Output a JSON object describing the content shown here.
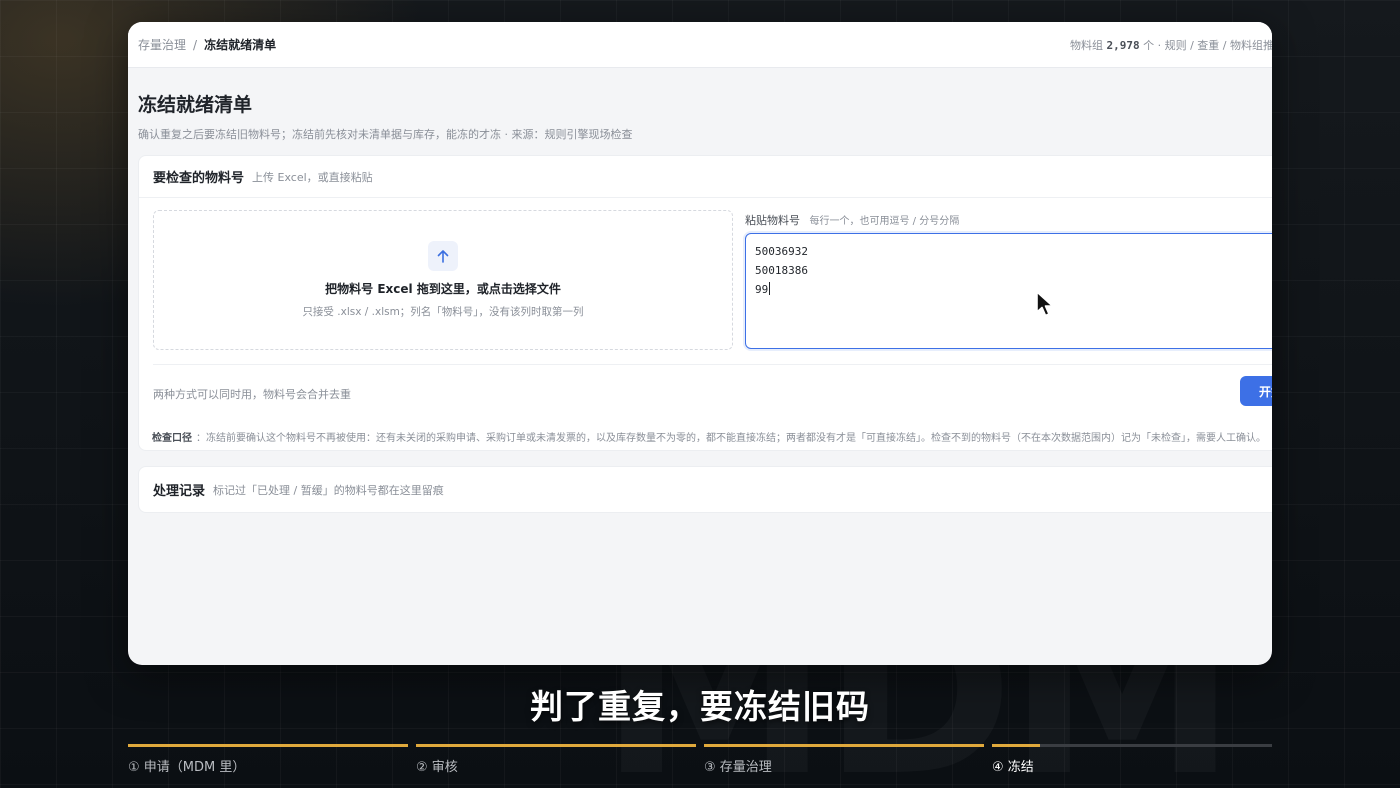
{
  "colors": {
    "accent": "#3d70e6",
    "progress": "#e0a93c",
    "progress_track": "#3a3d42"
  },
  "breadcrumb": {
    "parent": "存量治理",
    "separator": "/",
    "current": "冻结就绪清单"
  },
  "topbar_right": {
    "prefix": "物料组",
    "count": "2,978",
    "suffix": "个 · 规则 / 查重 / 物料组推"
  },
  "page": {
    "title": "冻结就绪清单",
    "description": "确认重复之后要冻结旧物料号；冻结前先核对未清单据与库存，能冻的才冻 · 来源：规则引擎现场检查"
  },
  "input_card": {
    "title": "要检查的物料号",
    "subtitle": "上传 Excel，或直接粘贴",
    "dropzone": {
      "icon": "upload-arrow-icon",
      "title": "把物料号 Excel 拖到这里，或点击选择文件",
      "hint": "只接受 .xlsx / .xlsm；列名「物料号」，没有该列时取第一列"
    },
    "paste": {
      "label": "粘贴物料号",
      "hint": "每行一个，也可用逗号 / 分号分隔",
      "lines": [
        "50036932",
        "50018386",
        "99"
      ]
    },
    "merge_note": "两种方式可以同时用，物料号会合并去重",
    "start_button": "开始"
  },
  "rule": {
    "label": "检查口径",
    "text": "：冻结前要确认这个物料号不再被使用：还有未关闭的采购申请、采购订单或未清发票的，以及库存数量不为零的，都不能直接冻结；两者都没有才是「可直接冻结」。检查不到的物料号（不在本次数据范围内）记为「未检查」，需要人工确认。"
  },
  "log_card": {
    "title": "处理记录",
    "subtitle": "标记过「已处理 / 暂缓」的物料号都在这里留痕"
  },
  "subtitle": "判了重复，要冻结旧码",
  "steps": [
    {
      "label": "① 申请（MDM 里）",
      "progress": 1.0
    },
    {
      "label": "② 审核",
      "progress": 1.0
    },
    {
      "label": "③ 存量治理",
      "progress": 1.0
    },
    {
      "label": "④ 冻结",
      "progress": 0.17
    }
  ]
}
